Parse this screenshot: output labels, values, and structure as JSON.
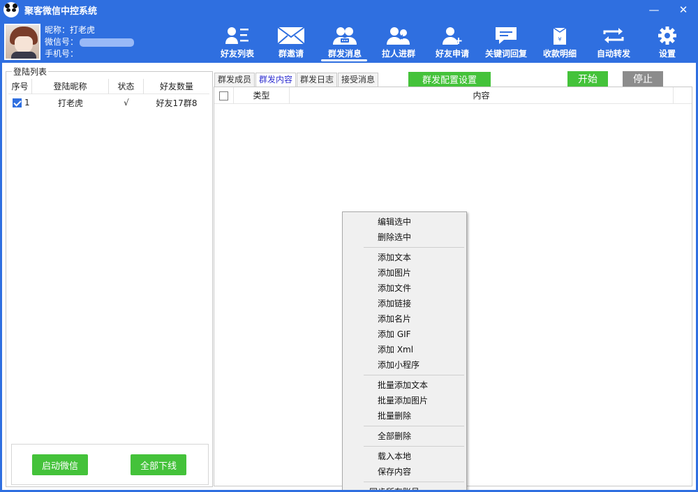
{
  "window": {
    "title": "聚客微信中控系统",
    "minimize": "—",
    "close": "✕"
  },
  "profile": {
    "nickname_label": "昵称：",
    "nickname": "打老虎",
    "wechat_label": "微信号：",
    "wechat_visible": "",
    "phone_label": "手机号：",
    "phone_visible": ""
  },
  "toolbar": [
    {
      "label": "好友列表",
      "icon": "friends-list-icon"
    },
    {
      "label": "群邀请",
      "icon": "mail-icon"
    },
    {
      "label": "群发消息",
      "icon": "group-message-icon",
      "active": true
    },
    {
      "label": "拉人进群",
      "icon": "pull-into-group-icon"
    },
    {
      "label": "好友申请",
      "icon": "add-friend-icon"
    },
    {
      "label": "关键词回复",
      "icon": "chat-bubble-icon"
    },
    {
      "label": "收款明细",
      "icon": "payment-icon"
    },
    {
      "label": "自动转发",
      "icon": "repeat-icon"
    },
    {
      "label": "设置",
      "icon": "gear-icon"
    }
  ],
  "login_list": {
    "title": "登陆列表",
    "columns": [
      "序号",
      "登陆昵称",
      "状态",
      "好友数量"
    ],
    "rows": [
      {
        "checked": true,
        "index": "1",
        "nickname": "打老虎",
        "status": "√",
        "count": "好友17群8"
      }
    ],
    "start_wechat": "启动微信",
    "all_offline": "全部下线"
  },
  "tabs": [
    {
      "label": "群发成员",
      "active": false
    },
    {
      "label": "群发内容",
      "active": true
    },
    {
      "label": "群发日志",
      "active": false
    },
    {
      "label": "接受消息",
      "active": false
    }
  ],
  "actions": {
    "config": "群发配置设置",
    "start": "开始",
    "stop": "停止"
  },
  "content_table": {
    "columns": [
      "类型",
      "内容"
    ]
  },
  "context_menu": {
    "items": [
      "编辑选中",
      "删除选中",
      "添加文本",
      "添加图片",
      "添加文件",
      "添加链接",
      "添加名片",
      "添加 GIF",
      "添加 Xml",
      "添加小程序",
      "批量添加文本",
      "批量添加图片",
      "批量删除",
      "全部删除",
      "载入本地",
      "保存内容",
      "同步所有账号"
    ]
  }
}
